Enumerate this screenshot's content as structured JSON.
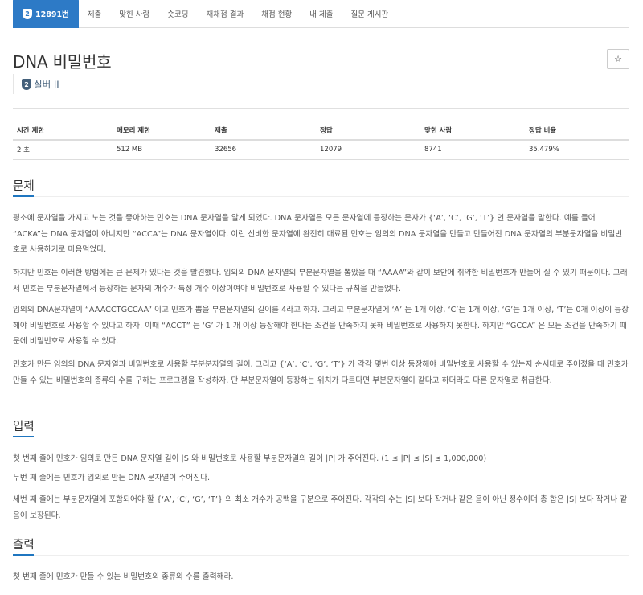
{
  "tabs": [
    {
      "badge": "2",
      "label": "12891번",
      "active": true
    },
    {
      "label": "제출"
    },
    {
      "label": "맞힌 사람"
    },
    {
      "label": "숏코딩"
    },
    {
      "label": "재채점 결과"
    },
    {
      "label": "채점 현황"
    },
    {
      "label": "내 제출"
    },
    {
      "label": "질문 게시판"
    }
  ],
  "problem": {
    "title": "DNA 비밀번호",
    "star_glyph": "☆",
    "tier_badge": "2",
    "tier_label": "실버 II"
  },
  "stats": {
    "headers": [
      "시간 제한",
      "메모리 제한",
      "제출",
      "정답",
      "맞힌 사람",
      "정답 비율"
    ],
    "values": [
      "2 초",
      "512 MB",
      "32656",
      "12079",
      "8741",
      "35.479%"
    ]
  },
  "sections": {
    "problem": {
      "heading": "문제",
      "paragraphs": [
        "평소에 문자열을 가지고 노는 것을 좋아하는 민호는 DNA 문자열을 알게 되었다. DNA 문자열은 모든 문자열에 등장하는 문자가 {‘A’, ‘C’, ‘G’, ‘T’} 인 문자열을 말한다. 예를 들어 “ACKA”는 DNA 문자열이 아니지만 “ACCA”는 DNA 문자열이다. 이런 신비한 문자열에 완전히 매료된 민호는 임의의 DNA 문자열을 만들고 만들어진 DNA 문자열의 부분문자열을 비밀번호로 사용하기로 마음먹었다.",
        "하지만 민호는 이러한 방법에는 큰 문제가 있다는 것을 발견했다. 임의의 DNA 문자열의 부분문자열을 뽑았을 때 “AAAA”와 같이 보안에 취약한 비밀번호가 만들어 질 수 있기 때문이다. 그래서 민호는 부분문자열에서 등장하는 문자의 개수가 특정 개수 이상이여야 비밀번호로 사용할 수 있다는 규칙을 만들었다.",
        "임의의 DNA문자열이 “AAACCTGCCAA” 이고 민호가 뽑을 부분문자열의 길이를 4라고 하자. 그리고 부분문자열에 ‘A’ 는 1개 이상, ‘C’는 1개 이상, ‘G’는 1개 이상, ‘T’는 0개 이상이 등장해야 비밀번호로 사용할 수 있다고 하자. 이때 “ACCT” 는 ‘G’ 가 1 개 이상 등장해야 한다는 조건을 만족하지 못해 비밀번호로 사용하지 못한다. 하지만 “GCCA” 은 모든 조건을 만족하기 때문에 비밀번호로 사용할 수 있다.",
        "민호가 만든 임의의 DNA 문자열과 비밀번호로 사용할 부분분자열의 길이, 그리고 {‘A’, ‘C’, ‘G’, ‘T’} 가 각각 몇번 이상 등장해야 비밀번호로 사용할 수 있는지 순서대로 주어졌을 때 민호가 만들 수 있는 비밀번호의 종류의 수를 구하는 프로그램을 작성하자. 단 부분문자열이 등장하는 위치가 다르다면 부분문자열이 같다고 하더라도 다른 문자열로 취급한다."
      ]
    },
    "input": {
      "heading": "입력",
      "paragraphs": [
        "첫 번째 줄에 민호가 임의로 만든 DNA 문자열 길이 |S|와 비밀번호로 사용할 부분문자열의 길이 |P| 가 주어진다. (1 ≤ |P| ≤ |S| ≤ 1,000,000)",
        "두번 째 줄에는 민호가 임의로 만든 DNA 문자열이 주어진다.",
        "세번 째 줄에는 부분문자열에 포함되어야 할 {‘A’, ‘C’, ‘G’, ‘T’} 의 최소 개수가 공백을 구분으로 주어진다. 각각의 수는 |S| 보다 작거나 같은 음이 아닌 정수이며 총 합은 |S| 보다 작거나 같음이 보장된다."
      ]
    },
    "output": {
      "heading": "출력",
      "paragraphs": [
        "첫 번째 줄에 민호가 만들 수 있는 비밀번호의 종류의 수를 출력해라."
      ]
    }
  }
}
